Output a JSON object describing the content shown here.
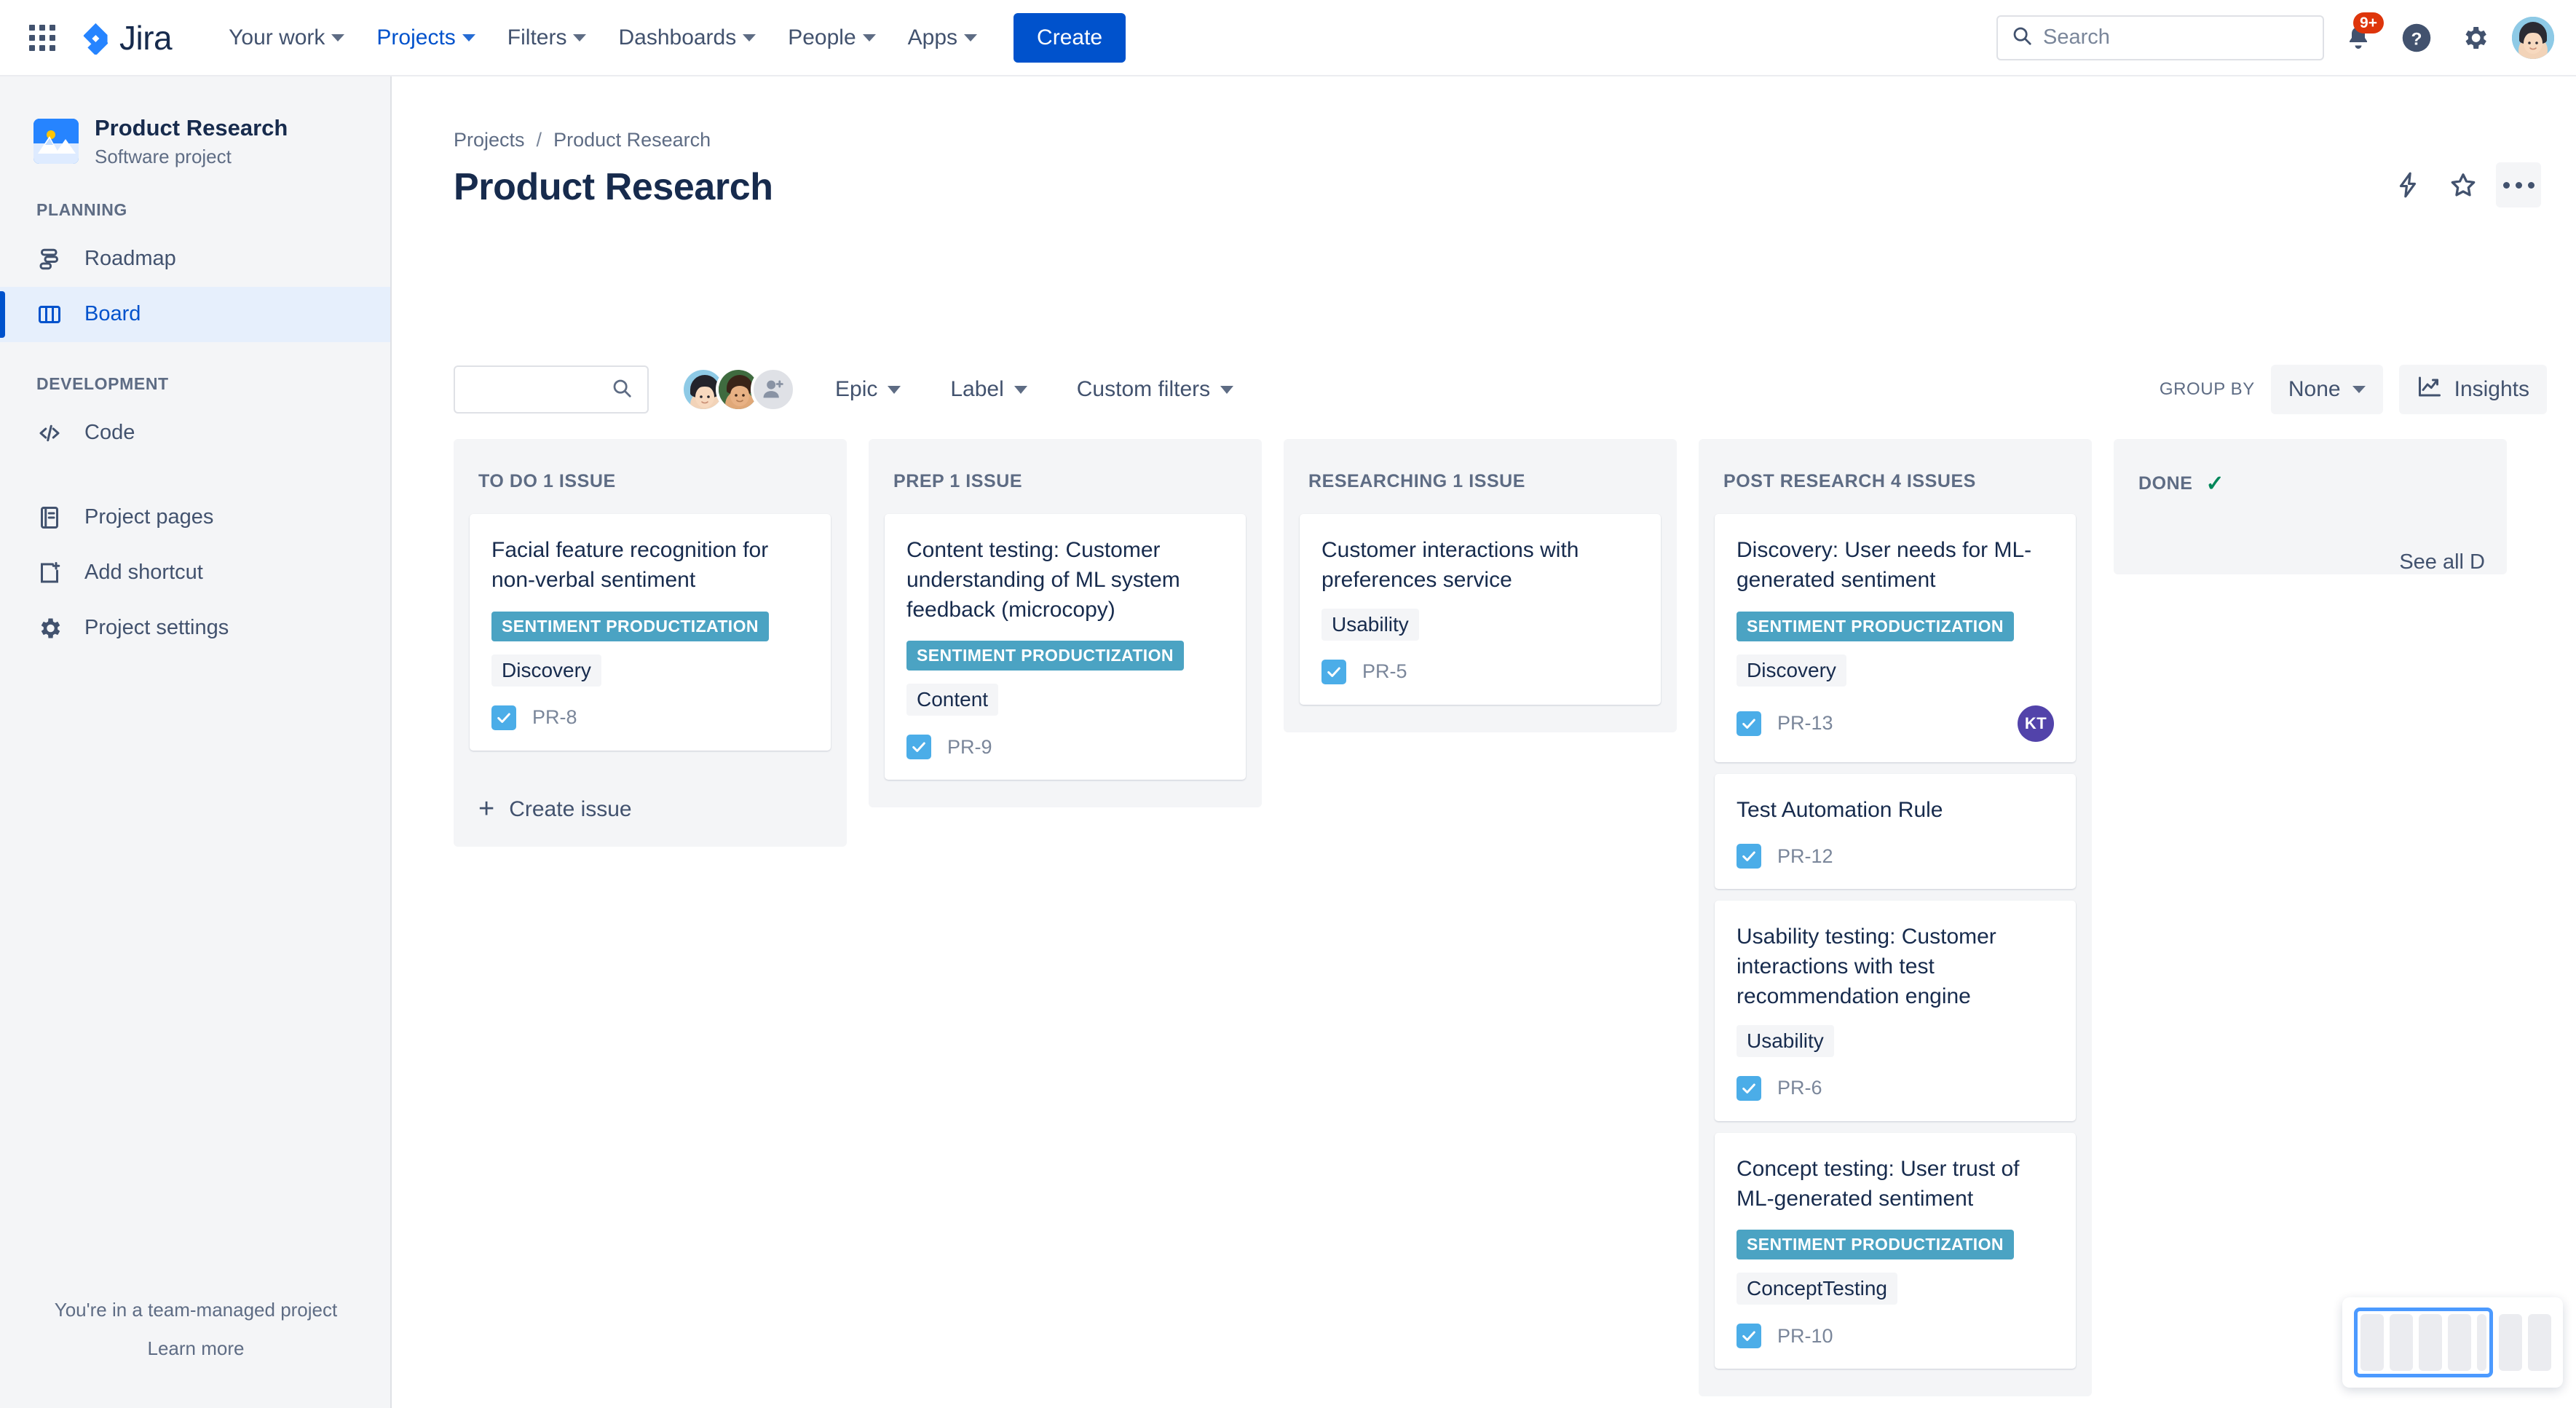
{
  "topnav": {
    "app_switcher_icon": "grid-apps-icon",
    "logo_text": "Jira",
    "items": [
      {
        "label": "Your work",
        "active": false
      },
      {
        "label": "Projects",
        "active": true
      },
      {
        "label": "Filters",
        "active": false
      },
      {
        "label": "Dashboards",
        "active": false
      },
      {
        "label": "People",
        "active": false
      },
      {
        "label": "Apps",
        "active": false
      }
    ],
    "create_label": "Create",
    "search_placeholder": "Search",
    "search_value": "",
    "notifications_badge": "9+",
    "icons": [
      "notification-bell-icon",
      "help-icon",
      "settings-gear-icon",
      "user-avatar"
    ]
  },
  "sidebar": {
    "project_name": "Product Research",
    "project_type": "Software project",
    "project_icon": "mountain-image-icon",
    "sections": [
      {
        "label": "PLANNING",
        "items": [
          {
            "label": "Roadmap",
            "icon": "roadmap-icon",
            "selected": false
          },
          {
            "label": "Board",
            "icon": "board-columns-icon",
            "selected": true
          }
        ]
      },
      {
        "label": "DEVELOPMENT",
        "items": [
          {
            "label": "Code",
            "icon": "code-brackets-icon",
            "selected": false
          }
        ]
      }
    ],
    "extra_items": [
      {
        "label": "Project pages",
        "icon": "page-document-icon"
      },
      {
        "label": "Add shortcut",
        "icon": "add-shortcut-icon"
      },
      {
        "label": "Project settings",
        "icon": "settings-gear-icon"
      }
    ],
    "footer_text": "You're in a team-managed project",
    "footer_link": "Learn more"
  },
  "header": {
    "breadcrumb": [
      "Projects",
      "Product Research"
    ],
    "breadcrumb_separator": "/",
    "title": "Product Research",
    "actions": [
      "automation-lightning-icon",
      "star-favorite-icon",
      "more-options-icon"
    ]
  },
  "toolbar": {
    "search_value": "",
    "search_placeholder": "",
    "search_icon": "search-icon",
    "avatars": [
      {
        "name": "member-1-avatar",
        "initials": ""
      },
      {
        "name": "member-2-avatar",
        "initials": ""
      }
    ],
    "add_people_icon": "add-person-icon",
    "filters": [
      {
        "label": "Epic"
      },
      {
        "label": "Label"
      },
      {
        "label": "Custom filters"
      }
    ],
    "group_by_label": "GROUP BY",
    "group_by_value": "None",
    "insights_label": "Insights",
    "insights_icon": "insights-chart-icon"
  },
  "board": {
    "create_issue_label": "Create issue",
    "columns": [
      {
        "id": "todo",
        "header": "TO DO 1 ISSUE",
        "show_create": true,
        "cards": [
          {
            "title": "Facial feature recognition for non-verbal sentiment",
            "epic": "SENTIMENT PRODUCTIZATION",
            "label": "Discovery",
            "key": "PR-8",
            "assignee": ""
          }
        ]
      },
      {
        "id": "prep",
        "header": "PREP 1 ISSUE",
        "show_create": false,
        "cards": [
          {
            "title": "Content testing: Customer understanding of ML system feedback (microcopy)",
            "epic": "SENTIMENT PRODUCTIZATION",
            "label": "Content",
            "key": "PR-9",
            "assignee": ""
          }
        ]
      },
      {
        "id": "researching",
        "header": "RESEARCHING 1 ISSUE",
        "show_create": false,
        "cards": [
          {
            "title": "Customer interactions with preferences service",
            "epic": "",
            "label": "Usability",
            "key": "PR-5",
            "assignee": ""
          }
        ]
      },
      {
        "id": "post-research",
        "header": "POST RESEARCH 4 ISSUES",
        "show_create": false,
        "cards": [
          {
            "title": "Discovery: User needs for ML-generated sentiment",
            "epic": "SENTIMENT PRODUCTIZATION",
            "label": "Discovery",
            "key": "PR-13",
            "assignee": "KT"
          },
          {
            "title": "Test Automation Rule",
            "epic": "",
            "label": "",
            "key": "PR-12",
            "assignee": ""
          },
          {
            "title": "Usability testing: Customer interactions with test recommendation engine",
            "epic": "",
            "label": "Usability",
            "key": "PR-6",
            "assignee": ""
          },
          {
            "title": "Concept testing: User trust of ML-generated sentiment",
            "epic": "SENTIMENT PRODUCTIZATION",
            "label": "ConceptTesting",
            "key": "PR-10",
            "assignee": ""
          }
        ]
      },
      {
        "id": "done",
        "header": "DONE",
        "done_check": "✓",
        "see_all": "See all D",
        "show_create": false,
        "cards": []
      }
    ]
  },
  "minimap": {
    "name": "board-minimap",
    "visible_columns": 4,
    "total_columns": 6
  },
  "colors": {
    "brand_blue": "#0052cc",
    "epic_teal": "#4BA3C3",
    "done_green": "#00875a",
    "badge_red": "#de350b",
    "assignee_purple": "#5243aa",
    "sidebar_bg": "#f4f5f7"
  }
}
